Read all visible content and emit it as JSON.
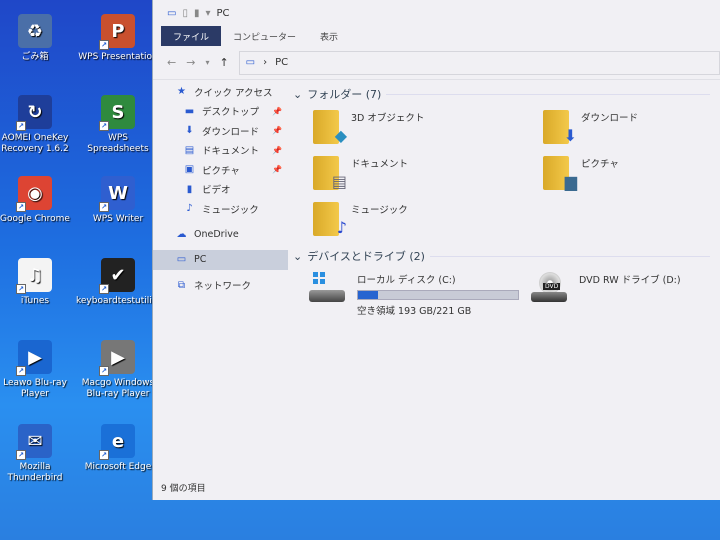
{
  "desktop": {
    "icons": [
      {
        "label": "ごみ箱",
        "color": "#4a6fa8",
        "glyph": "♻"
      },
      {
        "label": "WPS Presentation",
        "color": "#c9502e",
        "glyph": "P"
      },
      {
        "label": "AOMEI OneKey Recovery 1.6.2",
        "color": "#1e3e9a",
        "glyph": "↻"
      },
      {
        "label": "WPS Spreadsheets",
        "color": "#2f8a3e",
        "glyph": "S"
      },
      {
        "label": "Google Chrome",
        "color": "#dd4433",
        "glyph": "◉"
      },
      {
        "label": "WPS Writer",
        "color": "#2f5fd0",
        "glyph": "W"
      },
      {
        "label": "iTunes",
        "color": "#f4f4f4",
        "glyph": "♫"
      },
      {
        "label": "keyboardtestutility",
        "color": "#222",
        "glyph": "✔"
      },
      {
        "label": "Leawo Blu-ray Player",
        "color": "#1a66d0",
        "glyph": "▶"
      },
      {
        "label": "Macgo Windows Blu-ray Player",
        "color": "#777",
        "glyph": "▶"
      },
      {
        "label": "Mozilla Thunderbird",
        "color": "#2a63c8",
        "glyph": "✉"
      },
      {
        "label": "Microsoft Edge",
        "color": "#1a70d8",
        "glyph": "e"
      }
    ]
  },
  "explorer": {
    "title": "PC",
    "tabs": [
      "ファイル",
      "コンピューター",
      "表示"
    ],
    "address": "PC",
    "nav": [
      {
        "label": "クイック アクセス",
        "icon": "star-icon",
        "glyph": "★",
        "top": true
      },
      {
        "label": "デスクトップ",
        "icon": "desktop-icon",
        "glyph": "▬",
        "pin": true
      },
      {
        "label": "ダウンロード",
        "icon": "download-icon",
        "glyph": "⬇",
        "pin": true
      },
      {
        "label": "ドキュメント",
        "icon": "document-icon",
        "glyph": "▤",
        "pin": true
      },
      {
        "label": "ピクチャ",
        "icon": "picture-icon",
        "glyph": "▣",
        "pin": true
      },
      {
        "label": "ビデオ",
        "icon": "video-icon",
        "glyph": "▮"
      },
      {
        "label": "ミュージック",
        "icon": "music-icon",
        "glyph": "♪"
      },
      {
        "label": "OneDrive",
        "icon": "cloud-icon",
        "glyph": "☁",
        "top": true
      },
      {
        "label": "PC",
        "icon": "pc-icon",
        "glyph": "▭",
        "top": true,
        "selected": true
      },
      {
        "label": "ネットワーク",
        "icon": "network-icon",
        "glyph": "⧉",
        "top": true
      }
    ],
    "folders_header": "フォルダー (7)",
    "folders": [
      {
        "label": "3D オブジェクト",
        "overlay": "◆",
        "color": "#2a8fc0"
      },
      {
        "label": "ダウンロード",
        "overlay": "⬇",
        "color": "#2a5ad0"
      },
      {
        "label": "ドキュメント",
        "overlay": "▤",
        "color": "#667"
      },
      {
        "label": "ピクチャ",
        "overlay": "▆",
        "color": "#3a6a90"
      },
      {
        "label": "ミュージック",
        "overlay": "♪",
        "color": "#2a4ad0"
      }
    ],
    "drives_header": "デバイスとドライブ (2)",
    "drives": [
      {
        "label": "ローカル ディスク (C:)",
        "free": "空き領域 193 GB/221 GB",
        "used_fraction": 0.127
      },
      {
        "label": "DVD RW ドライブ (D:)",
        "badge": "DVD"
      }
    ],
    "status": "9 個の項目"
  }
}
